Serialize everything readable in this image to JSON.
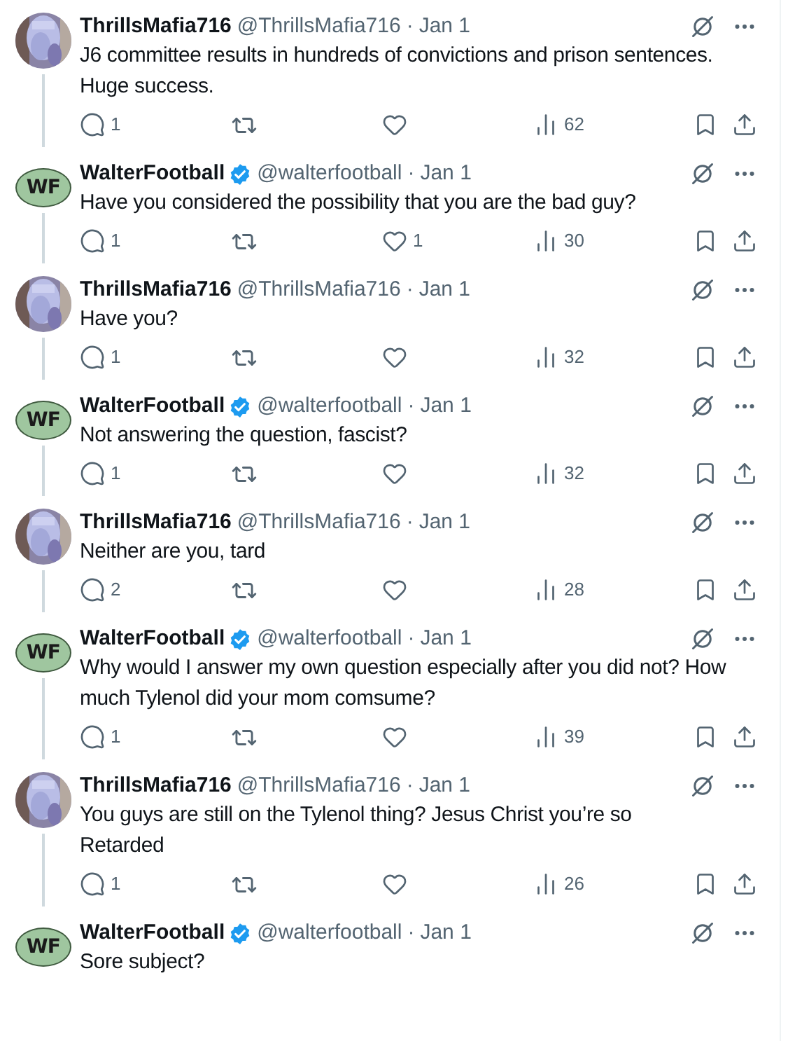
{
  "tweets": [
    {
      "author": {
        "name": "ThrillsMafia716",
        "handle": "@ThrillsMafia716",
        "verified": false
      },
      "separator": "·",
      "date": "Jan 1",
      "text": "J6 committee results in hundreds of convictions and prison sentences. Huge success.",
      "replies": "1",
      "views": "62",
      "thread_continues": true
    },
    {
      "author": {
        "name": "WalterFootball",
        "handle": "@walterfootball",
        "verified": true,
        "avatar": {
          "kind": "logo",
          "text": "WF"
        }
      },
      "separator": "·",
      "date": "Jan 1",
      "text": "Have you considered the possibility that you are the bad guy?",
      "replies": "1",
      "likes": "1",
      "views": "30",
      "thread_continues": true
    },
    {
      "author": {
        "name": "ThrillsMafia716",
        "handle": "@ThrillsMafia716",
        "verified": false
      },
      "separator": "·",
      "date": "Jan 1",
      "text": "Have you?",
      "replies": "1",
      "views": "32",
      "thread_continues": true
    },
    {
      "author": {
        "name": "WalterFootball",
        "handle": "@walterfootball",
        "verified": true,
        "avatar": {
          "kind": "logo",
          "text": "WF"
        }
      },
      "separator": "·",
      "date": "Jan 1",
      "text": "Not answering the question, fascist?",
      "replies": "1",
      "views": "32",
      "thread_continues": true
    },
    {
      "author": {
        "name": "ThrillsMafia716",
        "handle": "@ThrillsMafia716",
        "verified": false
      },
      "separator": "·",
      "date": "Jan 1",
      "text": "Neither are you, tard",
      "replies": "2",
      "views": "28",
      "thread_continues": true
    },
    {
      "author": {
        "name": "WalterFootball",
        "handle": "@walterfootball",
        "verified": true,
        "avatar": {
          "kind": "logo",
          "text": "WF"
        }
      },
      "separator": "·",
      "date": "Jan 1",
      "text": "Why would I answer my own question especially after you did not? How much Tylenol did your mom comsume?",
      "replies": "1",
      "views": "39",
      "thread_continues": true
    },
    {
      "author": {
        "name": "ThrillsMafia716",
        "handle": "@ThrillsMafia716",
        "verified": false
      },
      "separator": "·",
      "date": "Jan 1",
      "text": "You guys are still on the Tylenol thing? Jesus Christ you’re so\nRetarded",
      "replies": "1",
      "views": "26",
      "thread_continues": true
    },
    {
      "author": {
        "name": "WalterFootball",
        "handle": "@walterfootball",
        "verified": true,
        "avatar": {
          "kind": "logo",
          "text": "WF"
        }
      },
      "separator": "·",
      "date": "Jan 1",
      "text": "Sore subject?",
      "thread_continues": false
    }
  ]
}
